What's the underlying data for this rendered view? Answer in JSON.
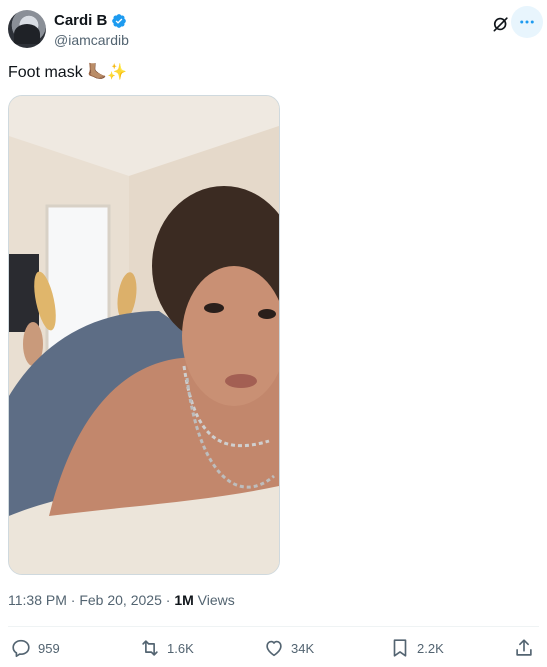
{
  "author": {
    "display_name": "Cardi B",
    "handle": "@iamcardib",
    "verified": true
  },
  "tweet": {
    "text": "Foot mask",
    "emojis": [
      "🦶🏽",
      "✨"
    ]
  },
  "meta": {
    "time": "11:38 PM",
    "separator1": " · ",
    "date": "Feb 20, 2025",
    "separator2": " · ",
    "views_count": "1M",
    "views_label": " Views"
  },
  "actions": {
    "replies": "959",
    "reposts": "1.6K",
    "likes": "34K",
    "bookmarks": "2.2K"
  },
  "icons": {
    "verified": "verified-badge-icon",
    "grok": "grok-icon",
    "more": "more-icon",
    "reply": "reply-icon",
    "repost": "repost-icon",
    "like": "heart-icon",
    "bookmark": "bookmark-icon",
    "share": "share-icon"
  },
  "colors": {
    "accent": "#1d9bf0",
    "muted": "#536471",
    "text": "#0f1419"
  }
}
